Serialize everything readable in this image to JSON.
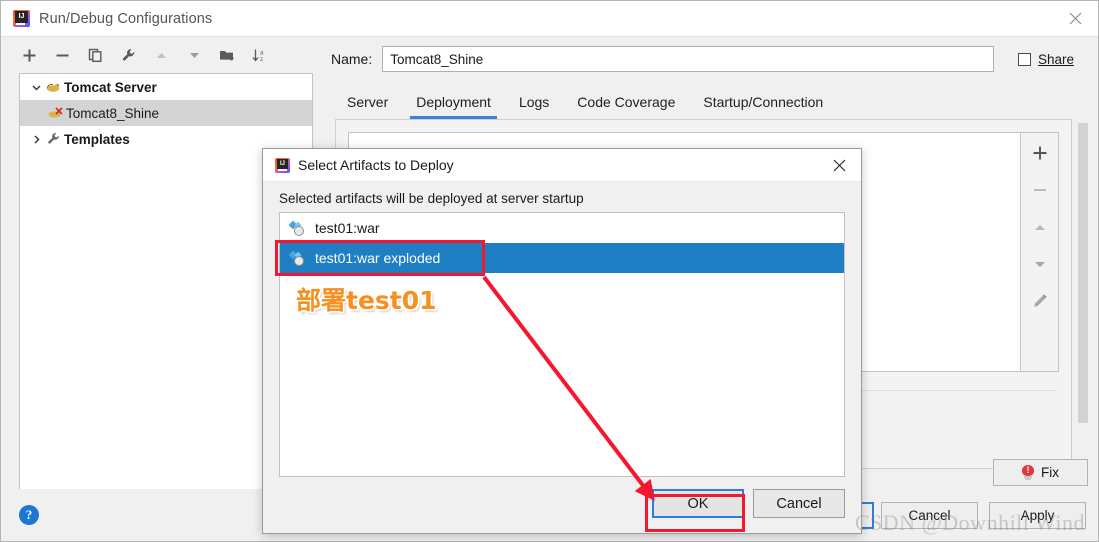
{
  "window": {
    "title": "Run/Debug Configurations",
    "logo_icon": "intellij-idea-logo-icon",
    "close_icon": "close-icon"
  },
  "toolbar": {
    "buttons": [
      {
        "name": "add",
        "icon": "plus-icon"
      },
      {
        "name": "remove",
        "icon": "minus-icon"
      },
      {
        "name": "copy",
        "icon": "copy-icon"
      },
      {
        "name": "edit-templates",
        "icon": "wrench-icon"
      },
      {
        "name": "move-up",
        "icon": "triangle-up-icon"
      },
      {
        "name": "move-down",
        "icon": "triangle-down-icon"
      },
      {
        "name": "move-into-folder",
        "icon": "folder-add-icon"
      },
      {
        "name": "sort-alphabetically",
        "icon": "sort-az-icon"
      }
    ]
  },
  "sidebar": {
    "items": [
      {
        "label": "Tomcat Server",
        "icon": "tomcat-icon",
        "expanded": true,
        "chevron": "chevron-down-icon",
        "bold": true,
        "selected": false
      },
      {
        "label": "Tomcat8_Shine",
        "icon": "tomcat-error-icon",
        "expanded": null,
        "chevron": "",
        "bold": false,
        "selected": true
      },
      {
        "label": "Templates",
        "icon": "wrench-icon",
        "expanded": false,
        "chevron": "chevron-right-icon",
        "bold": true,
        "selected": false
      }
    ],
    "help_label": "?",
    "help_icon": "help-icon"
  },
  "name_row": {
    "label": "Name:",
    "value": "Tomcat8_Shine",
    "placeholder": "",
    "share_label": "Share",
    "share_checked": false
  },
  "tabs": [
    {
      "label": "Server",
      "active": false
    },
    {
      "label": "Deployment",
      "active": true
    },
    {
      "label": "Logs",
      "active": false
    },
    {
      "label": "Code Coverage",
      "active": false
    },
    {
      "label": "Startup/Connection",
      "active": false
    }
  ],
  "panel": {
    "side_buttons": [
      {
        "name": "add-artifact",
        "icon": "plus-icon",
        "enabled": true
      },
      {
        "name": "remove-artifact",
        "icon": "minus-icon",
        "enabled": false
      },
      {
        "name": "move-up-artifact",
        "icon": "triangle-up-icon",
        "enabled": false
      },
      {
        "name": "move-down-artifact",
        "icon": "triangle-down-icon",
        "enabled": false
      },
      {
        "name": "edit-artifact",
        "icon": "pencil-icon",
        "enabled": false
      }
    ],
    "scrollbar_icon": "vertical-scrollbar"
  },
  "footer": {
    "fix_label": "Fix",
    "fix_icon": "warning-bulb-icon",
    "ok_label": "OK",
    "cancel_label": "Cancel",
    "apply_label": "Apply"
  },
  "dialog": {
    "title": "Select Artifacts to Deploy",
    "logo_icon": "intellij-idea-logo-icon",
    "close_icon": "close-icon",
    "hint": "Selected artifacts will be deployed at server startup",
    "items": [
      {
        "label": "test01:war",
        "icon": "artifact-icon",
        "selected": false
      },
      {
        "label": "test01:war exploded",
        "icon": "artifact-icon",
        "selected": true
      }
    ],
    "ok_label": "OK",
    "cancel_label": "Cancel"
  },
  "annotations": {
    "note_text": "部署test01",
    "note_color": "#f79021",
    "highlight_color": "#f5172f",
    "arrow_icon": "red-arrow-annotation",
    "highlight_item_name": "test01:war exploded",
    "highlight_button_name": "OK"
  },
  "watermark": {
    "text": "CSDN @Downhill Wind"
  }
}
